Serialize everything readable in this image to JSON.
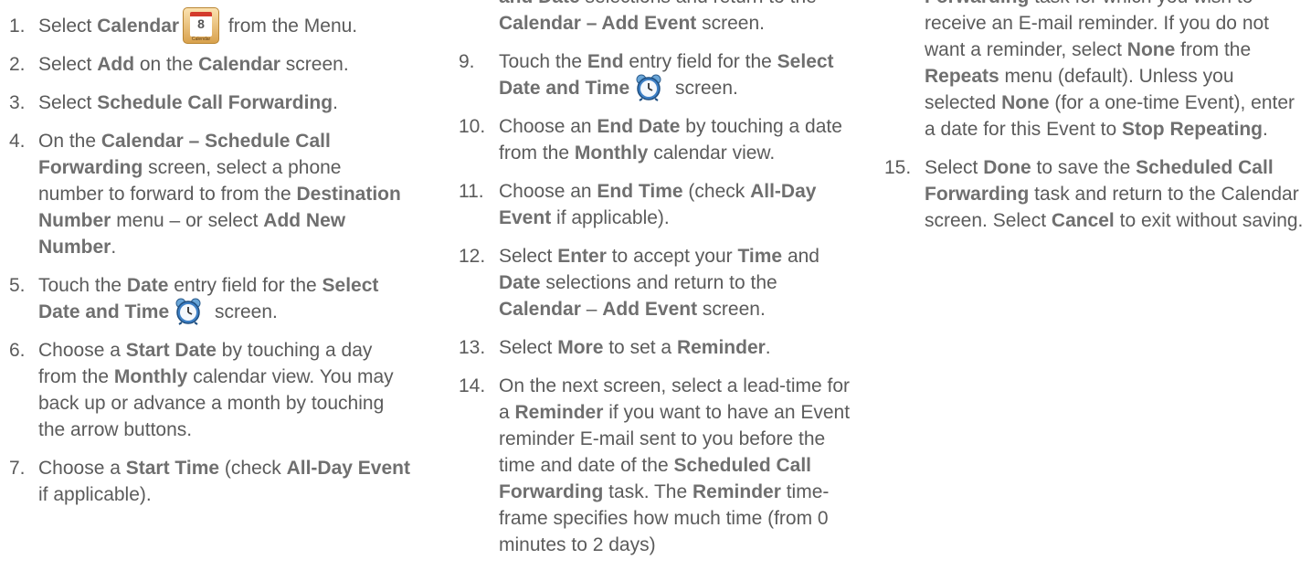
{
  "columns": [
    {
      "steps": [
        {
          "num": "1.",
          "parts": [
            {
              "t": "Select "
            },
            {
              "b": "Calendar"
            },
            {
              "icon": "calendar-icon"
            },
            {
              "t": " from the Menu."
            }
          ]
        },
        {
          "num": "2.",
          "parts": [
            {
              "t": "Select "
            },
            {
              "b": "Add"
            },
            {
              "t": " on the "
            },
            {
              "b": "Calendar"
            },
            {
              "t": " screen."
            }
          ]
        },
        {
          "num": "3.",
          "parts": [
            {
              "t": "Select "
            },
            {
              "b": "Schedule Call Forwarding"
            },
            {
              "t": "."
            }
          ]
        },
        {
          "num": "4.",
          "parts": [
            {
              "t": "On the "
            },
            {
              "b": "Calendar – Schedule Call Forwarding"
            },
            {
              "t": " screen, select a phone number to forward to from the "
            },
            {
              "b": "Destination Number"
            },
            {
              "t": " menu – or select "
            },
            {
              "b": "Add New Number"
            },
            {
              "t": "."
            }
          ]
        },
        {
          "num": "5.",
          "parts": [
            {
              "t": "Touch the "
            },
            {
              "b": "Date"
            },
            {
              "t": " entry field for the "
            },
            {
              "b": "Select Date and Time"
            },
            {
              "icon": "alarm-clock-icon"
            },
            {
              "t": " screen."
            }
          ]
        },
        {
          "num": "6.",
          "parts": [
            {
              "t": "Choose a "
            },
            {
              "b": "Start Date"
            },
            {
              "t": " by touching a day from the "
            },
            {
              "b": "Monthly"
            },
            {
              "t": " calendar view. You may back up or advance a month by touching the arrow buttons."
            }
          ]
        },
        {
          "num": "7.",
          "parts": [
            {
              "t": "Choose a "
            },
            {
              "b": "Start Time"
            },
            {
              "t": " (check "
            },
            {
              "b": "All-Day Event"
            },
            {
              "t": " if applicable)."
            }
          ]
        }
      ]
    },
    {
      "steps": [
        {
          "num": "",
          "parts": [
            {
              "b": "and Date"
            },
            {
              "t": " selections and return to the "
            },
            {
              "b": "Calendar – Add Event"
            },
            {
              "t": " screen."
            }
          ]
        },
        {
          "num": "9.",
          "parts": [
            {
              "t": "Touch the "
            },
            {
              "b": "End"
            },
            {
              "t": " entry field for the "
            },
            {
              "b": "Select Date and Time"
            },
            {
              "icon": "alarm-clock-icon"
            },
            {
              "t": " screen."
            }
          ]
        },
        {
          "num": "10.",
          "parts": [
            {
              "t": "Choose an "
            },
            {
              "b": "End Date"
            },
            {
              "t": " by touching a date from the "
            },
            {
              "b": "Monthly"
            },
            {
              "t": " calendar view."
            }
          ]
        },
        {
          "num": "11.",
          "parts": [
            {
              "t": "Choose an "
            },
            {
              "b": "End Time"
            },
            {
              "t": " (check "
            },
            {
              "b": "All-Day Event"
            },
            {
              "t": " if applicable)."
            }
          ]
        },
        {
          "num": "12.",
          "parts": [
            {
              "t": "Select "
            },
            {
              "b": "Enter"
            },
            {
              "t": " to accept your "
            },
            {
              "b": "Time"
            },
            {
              "t": " and "
            },
            {
              "b": "Date"
            },
            {
              "t": " selections and return to the "
            },
            {
              "b": "Calendar"
            },
            {
              "t": " – "
            },
            {
              "b": "Add Event"
            },
            {
              "t": " screen."
            }
          ]
        },
        {
          "num": "13.",
          "parts": [
            {
              "t": "Select "
            },
            {
              "b": "More"
            },
            {
              "t": " to set a "
            },
            {
              "b": "Reminder"
            },
            {
              "t": "."
            }
          ]
        },
        {
          "num": "14.",
          "parts": [
            {
              "t": "On the next screen, select a lead-time for a "
            },
            {
              "b": "Reminder"
            },
            {
              "t": " if you want to have an Event reminder E-mail sent to you before the time and date of the "
            },
            {
              "b": "Scheduled Call Forwarding"
            },
            {
              "t": " task. The "
            },
            {
              "b": "Reminder"
            },
            {
              "t": " time-frame specifies how much time (from 0 minutes to 2 days)"
            }
          ]
        }
      ]
    },
    {
      "steps": [
        {
          "num": "",
          "parts": [
            {
              "b": "Forwarding"
            },
            {
              "t": " task for which you wish to receive an E-mail reminder. If you do not want a reminder, select "
            },
            {
              "b": "None"
            },
            {
              "t": " from the "
            },
            {
              "b": "Repeats"
            },
            {
              "t": " menu (default). Unless you selected "
            },
            {
              "b": "None"
            },
            {
              "t": " (for a one-time Event), enter a date for this Event to "
            },
            {
              "b": "Stop Repeating"
            },
            {
              "t": "."
            }
          ]
        },
        {
          "num": "15.",
          "parts": [
            {
              "t": "Select "
            },
            {
              "b": "Done"
            },
            {
              "t": " to save the "
            },
            {
              "b": "Scheduled Call Forwarding"
            },
            {
              "t": " task and return to the Calendar screen. Select "
            },
            {
              "b": "Cancel"
            },
            {
              "t": " to exit without saving."
            }
          ]
        }
      ]
    }
  ],
  "calendar_icon": {
    "day": "8",
    "caption": "Calendar"
  },
  "colors": {
    "text": "#5b5b5b",
    "bold": "#6f6f6f"
  }
}
